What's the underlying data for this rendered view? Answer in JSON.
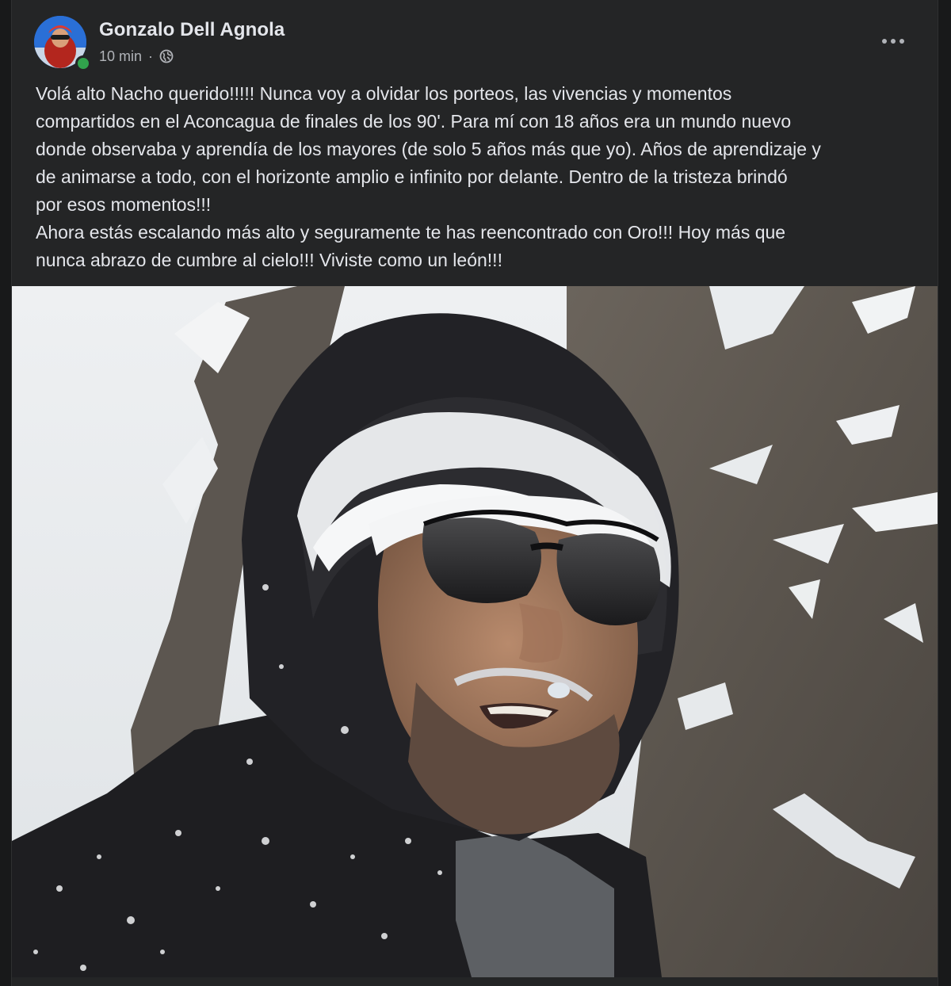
{
  "post": {
    "author": "Gonzalo Dell Agnola",
    "time": "10 min",
    "separator": "·",
    "privacy_icon": "globe-icon",
    "more_icon": "more-options-icon",
    "text_lines": [
      "Volá alto Nacho querido!!!!! Nunca voy a olvidar los porteos, las vivencias y momentos",
      "compartidos en el Aconcagua de finales de los 90'. Para mí con 18 años era un mundo nuevo",
      "donde observaba y aprendía de los mayores (de solo 5 años más que yo). Años de aprendizaje y",
      "de animarse a todo, con el horizonte amplio e infinito por delante. Dentro de la tristeza brindó",
      "por esos momentos!!!",
      "Ahora estás escalando más alto y seguramente te has reencontrado con Oro!!! Hoy más que",
      "nunca abrazo de cumbre al cielo!!! Viviste como un león!!!"
    ]
  },
  "colors": {
    "background": "#18191a",
    "card": "#242526",
    "text_primary": "#e4e6eb",
    "text_secondary": "#b0b3b8",
    "online": "#31a24c"
  }
}
